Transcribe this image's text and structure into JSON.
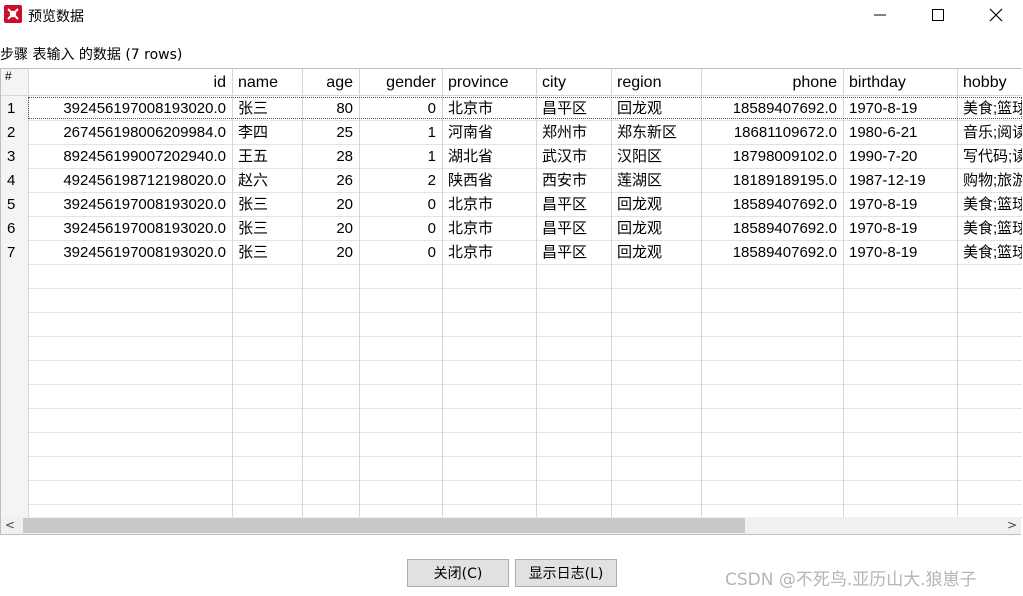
{
  "window": {
    "title": "预览数据",
    "step_label": "步骤 表输入 的数据  (7 rows)"
  },
  "grid": {
    "rownum_header": "#",
    "columns": [
      "id",
      "name",
      "age",
      "gender",
      "province",
      "city",
      "region",
      "phone",
      "birthday",
      "hobby"
    ],
    "rows": [
      {
        "n": "1",
        "id": "392456197008193020.0",
        "name": "张三",
        "age": "80",
        "gender": "0",
        "province": "北京市",
        "city": "昌平区",
        "region": "回龙观",
        "phone": "18589407692.0",
        "birthday": "1970-8-19",
        "hobby": "美食;篮球"
      },
      {
        "n": "2",
        "id": "267456198006209984.0",
        "name": "李四",
        "age": "25",
        "gender": "1",
        "province": "河南省",
        "city": "郑州市",
        "region": "郑东新区",
        "phone": "18681109672.0",
        "birthday": "1980-6-21",
        "hobby": "音乐;阅读"
      },
      {
        "n": "3",
        "id": "892456199007202940.0",
        "name": "王五",
        "age": "28",
        "gender": "1",
        "province": "湖北省",
        "city": "武汉市",
        "region": "汉阳区",
        "phone": "18798009102.0",
        "birthday": "1990-7-20",
        "hobby": "写代码;读"
      },
      {
        "n": "4",
        "id": "492456198712198020.0",
        "name": "赵六",
        "age": "26",
        "gender": "2",
        "province": "陕西省",
        "city": "西安市",
        "region": "莲湖区",
        "phone": "18189189195.0",
        "birthday": "1987-12-19",
        "hobby": "购物;旅游"
      },
      {
        "n": "5",
        "id": "392456197008193020.0",
        "name": "张三",
        "age": "20",
        "gender": "0",
        "province": "北京市",
        "city": "昌平区",
        "region": "回龙观",
        "phone": "18589407692.0",
        "birthday": "1970-8-19",
        "hobby": "美食;篮球"
      },
      {
        "n": "6",
        "id": "392456197008193020.0",
        "name": "张三",
        "age": "20",
        "gender": "0",
        "province": "北京市",
        "city": "昌平区",
        "region": "回龙观",
        "phone": "18589407692.0",
        "birthday": "1970-8-19",
        "hobby": "美食;篮球"
      },
      {
        "n": "7",
        "id": "392456197008193020.0",
        "name": "张三",
        "age": "20",
        "gender": "0",
        "province": "北京市",
        "city": "昌平区",
        "region": "回龙观",
        "phone": "18589407692.0",
        "birthday": "1970-8-19",
        "hobby": "美食;篮球"
      }
    ]
  },
  "scrollbar": {
    "left_arrow": "<",
    "right_arrow": ">"
  },
  "buttons": {
    "close": "关闭(C)",
    "show_log": "显示日志(L)"
  },
  "watermark": "CSDN @不死鸟.亚历山大.狼崽子"
}
